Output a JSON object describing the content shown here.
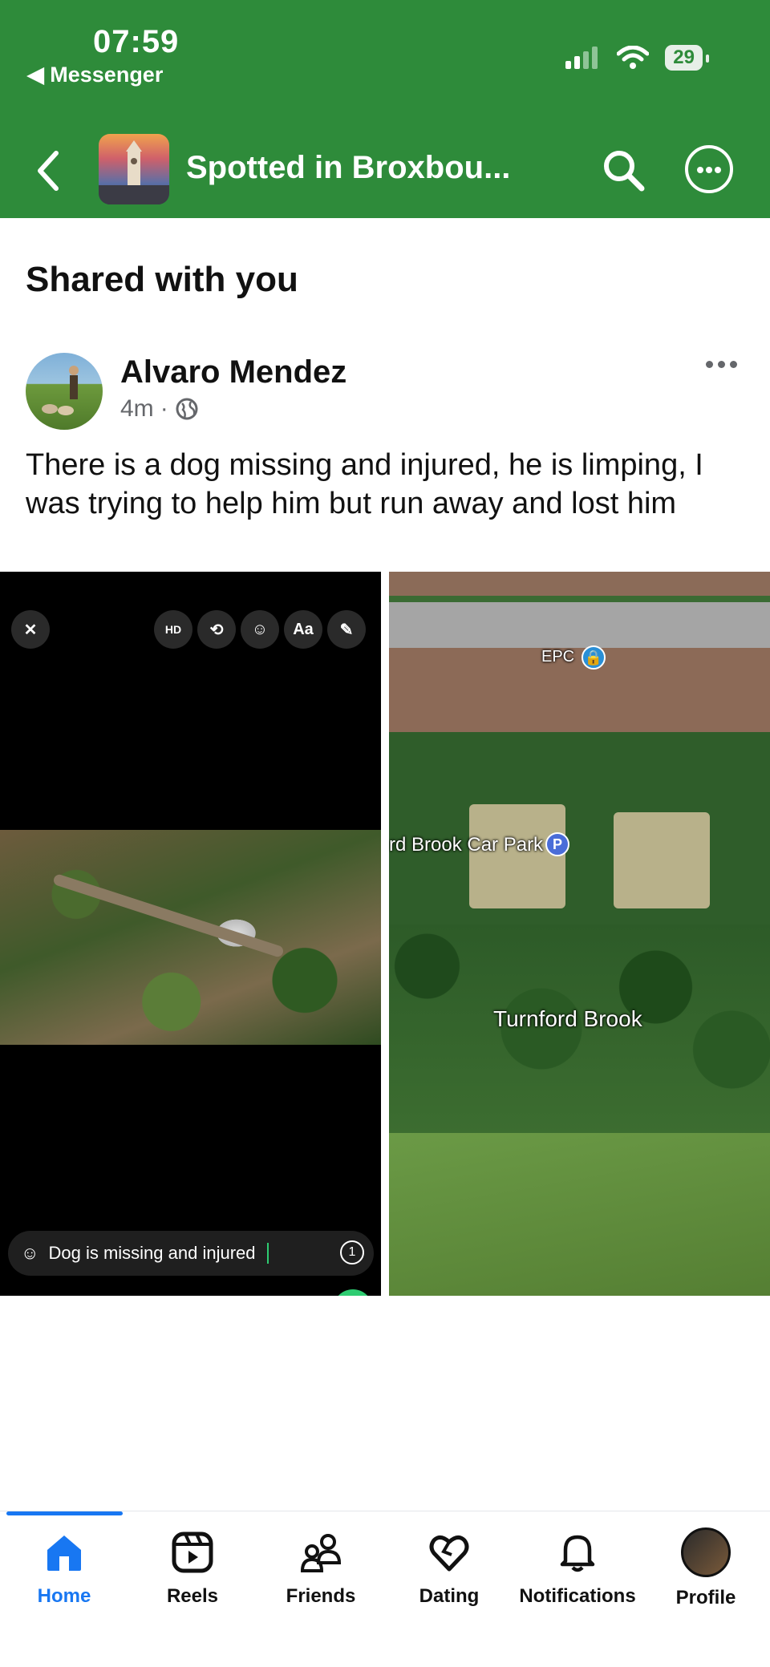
{
  "status_bar": {
    "time": "07:59",
    "back_app": "Messenger",
    "battery": "29"
  },
  "nav": {
    "group_title": "Spotted in Broxbou..."
  },
  "section_title": "Shared with you",
  "post": {
    "author": "Alvaro Mendez",
    "time": "4m",
    "text": "There is a dog missing and injured, he is limping, I was trying to help him but run away and lost him",
    "story": {
      "tools": [
        "HD",
        "crop",
        "sticker",
        "Aa",
        "draw"
      ],
      "caption": "Dog is missing and injured",
      "timer": "1"
    },
    "map": {
      "labels": {
        "epc": "EPC",
        "car_park": "rd Brook Car Park",
        "brook": "Turnford Brook"
      },
      "pin_letter": "P"
    }
  },
  "tabs": [
    {
      "label": "Home",
      "icon": "home-icon",
      "active": true
    },
    {
      "label": "Reels",
      "icon": "reels-icon"
    },
    {
      "label": "Friends",
      "icon": "friends-icon"
    },
    {
      "label": "Dating",
      "icon": "dating-icon"
    },
    {
      "label": "Notifications",
      "icon": "bell-icon"
    },
    {
      "label": "Profile",
      "icon": "profile-avatar"
    }
  ],
  "colors": {
    "header": "#2e8b3a",
    "accent": "#1877f2"
  }
}
